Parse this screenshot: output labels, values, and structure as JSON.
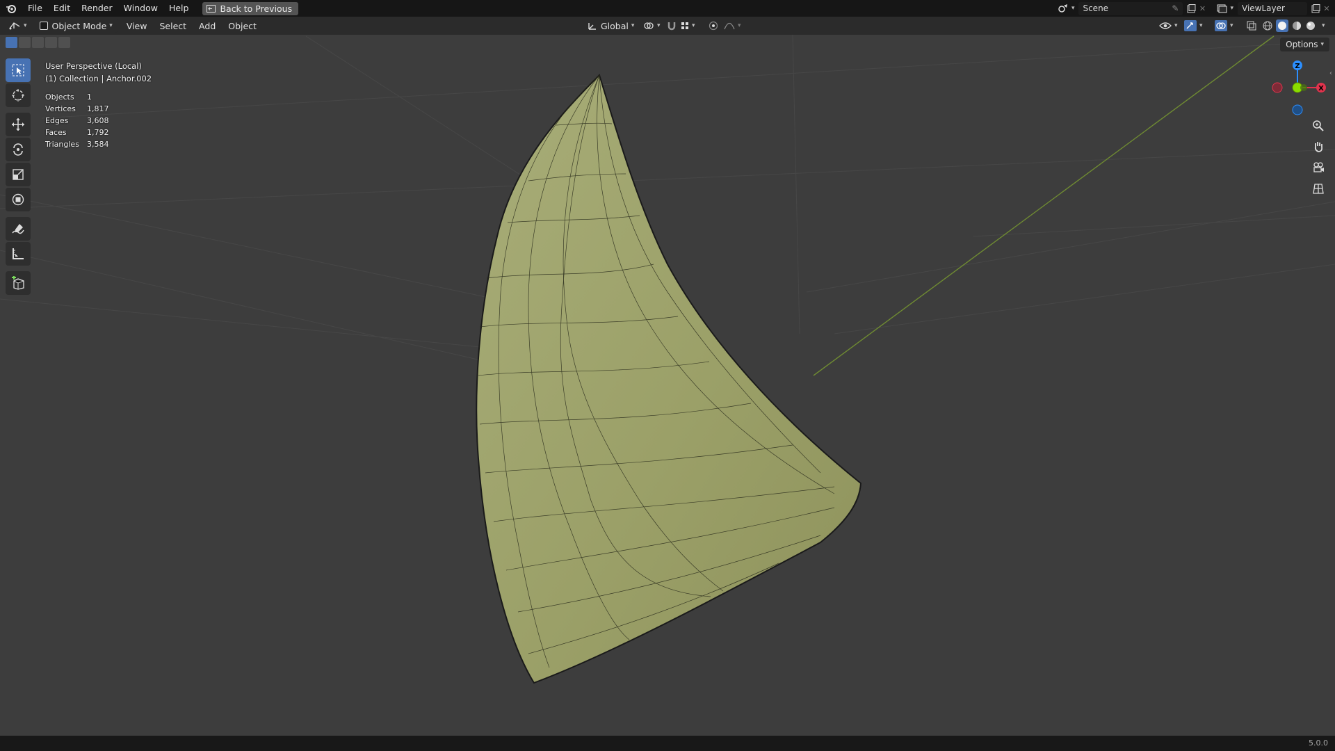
{
  "menu": {
    "items": [
      "File",
      "Edit",
      "Render",
      "Window",
      "Help"
    ],
    "back_button": "Back to Previous"
  },
  "topright": {
    "scene": "Scene",
    "view_layer": "ViewLayer"
  },
  "header": {
    "mode": "Object Mode",
    "view": "View",
    "select": "Select",
    "add": "Add",
    "object": "Object",
    "orientation": "Global",
    "options": "Options"
  },
  "overlay": {
    "perspective": "User Perspective (Local)",
    "collection": "(1) Collection | Anchor.002",
    "stats": [
      {
        "label": "Objects",
        "value": "1"
      },
      {
        "label": "Vertices",
        "value": "1,817"
      },
      {
        "label": "Edges",
        "value": "3,608"
      },
      {
        "label": "Faces",
        "value": "1,792"
      },
      {
        "label": "Triangles",
        "value": "3,584"
      }
    ]
  },
  "gizmo": {
    "z": "Z",
    "x": "X",
    "colors": {
      "x": "#e2334d",
      "y": "#8bdc00",
      "z": "#2c8fff"
    }
  },
  "tools": [
    "select-box",
    "cursor",
    "move",
    "rotate",
    "scale",
    "transform",
    "annotate",
    "measure",
    "add-cube"
  ],
  "mesh_color": "#9a9f6a",
  "status": {
    "version": "5.0.0"
  }
}
